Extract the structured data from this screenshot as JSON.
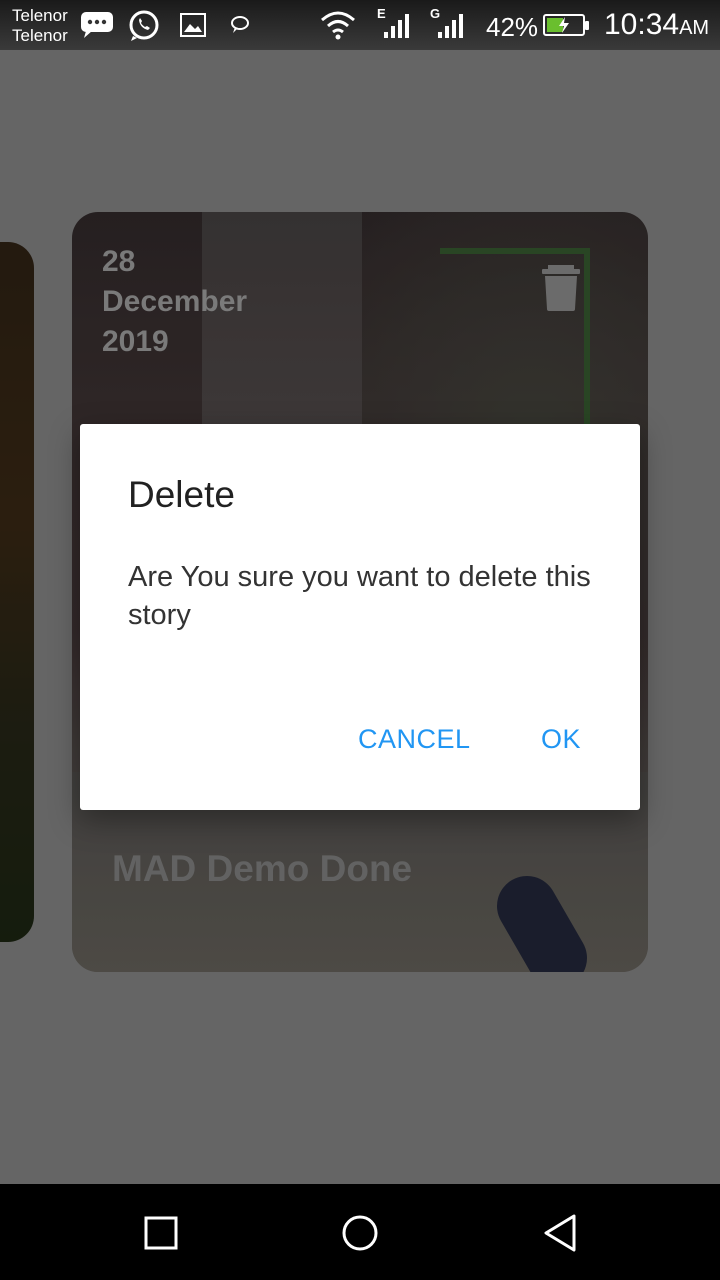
{
  "status_bar": {
    "carrier_1": "Telenor",
    "carrier_2": "Telenor",
    "network_1": "E",
    "network_2": "G",
    "battery_level": "42%",
    "battery_fraction": 0.42,
    "time": "10:34",
    "time_suffix": "AM"
  },
  "story_card": {
    "date_day": "28",
    "date_month": "December",
    "date_year": "2019",
    "title": "MAD Demo Done",
    "delete_icon": "trash-icon"
  },
  "dialog": {
    "title": "Delete",
    "message": "Are You sure you want to delete this story",
    "cancel_label": "CANCEL",
    "ok_label": "OK",
    "accent": "#2196f3"
  },
  "nav_bar": {
    "recents_icon": "square-icon",
    "home_icon": "circle-icon",
    "back_icon": "triangle-back-icon"
  }
}
